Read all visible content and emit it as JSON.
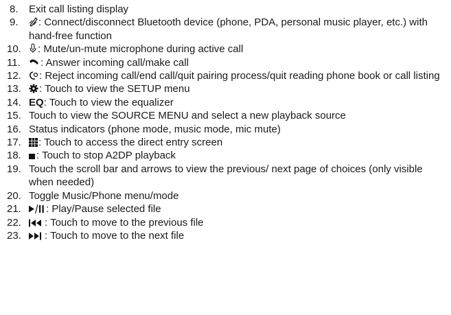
{
  "items": [
    {
      "num": "8.",
      "text": "Exit call listing display"
    },
    {
      "num": "9.",
      "icon_name": "bluetooth-connect-icon",
      "text": ": Connect/disconnect Bluetooth device (phone, PDA, personal music player, etc.) with hand-free function"
    },
    {
      "num": "10.",
      "icon_name": "microphone-icon",
      "text": ": Mute/un-mute microphone during active call"
    },
    {
      "num": "11.",
      "icon_name": "answer-call-icon",
      "text": ": Answer incoming call/make call"
    },
    {
      "num": "12.",
      "icon_name": "end-call-icon",
      "text": ": Reject incoming call/end call/quit pairing process/quit reading phone book or call listing"
    },
    {
      "num": "13.",
      "icon_name": "gear-icon",
      "text": ": Touch to view the SETUP menu"
    },
    {
      "num": "14.",
      "bold": "EQ",
      "text": ": Touch to view the equalizer"
    },
    {
      "num": "15.",
      "text": "Touch to view the SOURCE MENU and select a new playback source"
    },
    {
      "num": "16.",
      "text": "Status indicators (phone mode, music mode, mic mute)"
    },
    {
      "num": "17.",
      "icon_name": "keypad-grid-icon",
      "text": ": Touch to access the direct entry screen"
    },
    {
      "num": "18.",
      "icon_name": "stop-icon",
      "text": ": Touch to stop A2DP playback"
    },
    {
      "num": "19.",
      "text": "Touch the scroll bar and arrows to view the previous/ next page of choices (only visible when needed)"
    },
    {
      "num": "20.",
      "text": "Toggle Music/Phone menu/mode"
    },
    {
      "num": "21.",
      "icon_name": "play-pause-icon",
      "text": ": Play/Pause selected file"
    },
    {
      "num": "22.",
      "icon_name": "previous-track-icon",
      "text": ": Touch to move to the previous file"
    },
    {
      "num": "23.",
      "icon_name": "next-track-icon",
      "text": ": Touch to move to the next file"
    }
  ]
}
